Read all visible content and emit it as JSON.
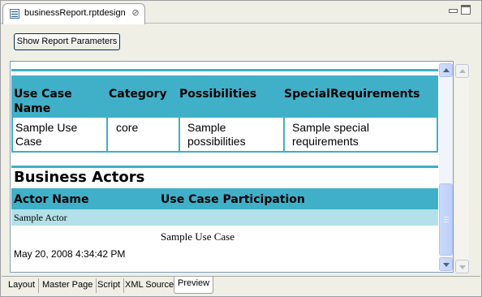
{
  "editor_tab": {
    "title": "businessReport.rptdesign",
    "close_glyph": "⊘",
    "icon": "report-design-icon"
  },
  "toolbar": {
    "show_params_label": "Show Report Parameters"
  },
  "use_case_table": {
    "headers": [
      "Use Case Name",
      "Category",
      "Possibilities",
      "SpecialRequirements"
    ],
    "header_lines": {
      "col0_line1": "Use Case",
      "col0_line2": "Name"
    },
    "rows": [
      {
        "name_line1": "Sample Use",
        "name_line2": "Case",
        "category": "core",
        "possibilities_line1": "Sample",
        "possibilities_line2": "possibilities",
        "requirements_line1": "Sample special",
        "requirements_line2": "requirements"
      }
    ]
  },
  "business_actors": {
    "title": "Business Actors",
    "headers": [
      "Actor Name",
      "Use Case Participation"
    ],
    "actor_name": "Sample Actor",
    "participation": "Sample Use Case",
    "timestamp": "May 20, 2008 4:34:42 PM"
  },
  "bottom_tabs": [
    "Layout",
    "Master Page",
    "Script",
    "XML Source",
    "Preview"
  ],
  "active_tab": "Preview",
  "colors": {
    "table_header": "#3fb0c8",
    "row_highlight": "#b4e1e9"
  }
}
